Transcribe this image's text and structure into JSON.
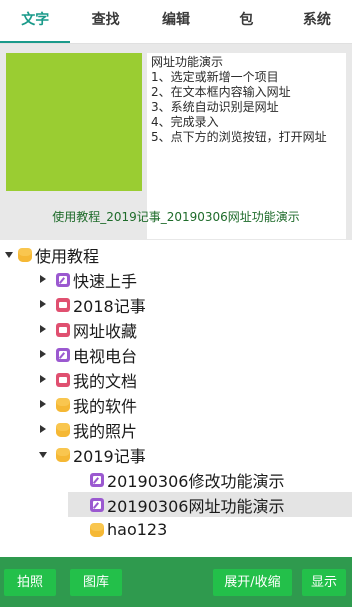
{
  "tabs": [
    {
      "label": "文字",
      "active": true
    },
    {
      "label": "查找",
      "active": false
    },
    {
      "label": "编辑",
      "active": false
    },
    {
      "label": "包",
      "active": false
    },
    {
      "label": "系统",
      "active": false
    }
  ],
  "preview": {
    "swatch_color": "#9acd32",
    "lines": [
      "网址功能演示",
      "1、选定或新增一个项目",
      "2、在文本框内容输入网址",
      "3、系统自动识别是网址",
      "4、完成录入",
      "5、点下方的浏览按钮，打开网址"
    ],
    "caption": "使用教程_2019记事_20190306网址功能演示"
  },
  "tree": {
    "root": {
      "label": "使用教程",
      "icon": "folder-icon",
      "expanded": true
    },
    "items": [
      {
        "label": "快速上手",
        "icon": "note-icon",
        "arrow": "right"
      },
      {
        "label": "2018记事",
        "icon": "book-icon",
        "arrow": "right"
      },
      {
        "label": "网址收藏",
        "icon": "book-icon",
        "arrow": "right"
      },
      {
        "label": "电视电台",
        "icon": "note-icon",
        "arrow": "right"
      },
      {
        "label": "我的文档",
        "icon": "book-icon",
        "arrow": "right"
      },
      {
        "label": "我的软件",
        "icon": "folder-icon",
        "arrow": "right"
      },
      {
        "label": "我的照片",
        "icon": "folder-icon",
        "arrow": "right"
      },
      {
        "label": "2019记事",
        "icon": "folder-icon",
        "arrow": "down"
      }
    ],
    "children": [
      {
        "label": "20190306修改功能演示",
        "icon": "note-icon",
        "selected": false
      },
      {
        "label": "20190306网址功能演示",
        "icon": "note-icon",
        "selected": true
      }
    ],
    "extra": {
      "label": "hao123",
      "icon": "folder-icon"
    }
  },
  "buttons": {
    "photo": "拍照",
    "gallery": "图库",
    "expand_collapse": "展开/收缩",
    "show": "显示"
  },
  "colors": {
    "accent": "#1a9a8a",
    "bottom_bar": "#2f9a4e",
    "button": "#23c04a",
    "caption_text": "#1e6b2a"
  }
}
